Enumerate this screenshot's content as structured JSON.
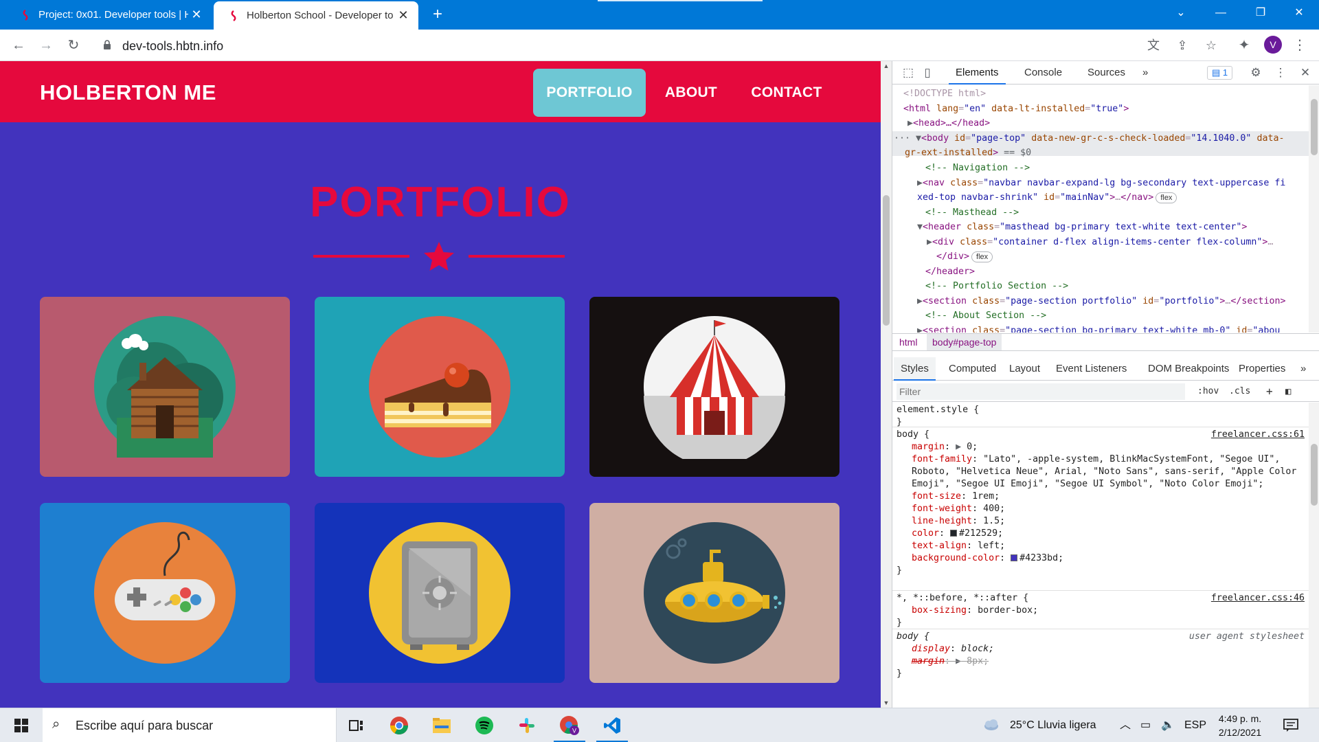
{
  "browser": {
    "tabs": [
      {
        "title": "Project: 0x01. Developer tools | H",
        "active": false
      },
      {
        "title": "Holberton School - Developer to",
        "active": true
      }
    ],
    "new_tab_icon": "plus-icon",
    "url": "dev-tools.hbtn.info",
    "profile_initial": "V"
  },
  "site": {
    "brand": "HOLBERTON ME",
    "nav": [
      {
        "label": "PORTFOLIO",
        "active": true
      },
      {
        "label": "ABOUT",
        "active": false
      },
      {
        "label": "CONTACT",
        "active": false
      }
    ],
    "section_title": "PORTFOLIO",
    "colors": {
      "primary": "#e5093d",
      "background": "#4233bd",
      "active_nav": "#6ec7d4"
    },
    "portfolio_items": [
      {
        "name": "cabin",
        "bg": "#b85a6e"
      },
      {
        "name": "cake",
        "bg": "#1fa3b6"
      },
      {
        "name": "circus",
        "bg": "#151010"
      },
      {
        "name": "game-controller",
        "bg": "#1e7fd0"
      },
      {
        "name": "safe",
        "bg": "#1433ba"
      },
      {
        "name": "submarine",
        "bg": "#cfaea3"
      }
    ]
  },
  "devtools": {
    "tabs": [
      "Elements",
      "Console",
      "Sources"
    ],
    "more_tabs": "»",
    "issues_count": "1",
    "dom": {
      "doctype": "<!DOCTYPE html>",
      "html_tag": "html",
      "html_attr": "lang",
      "html_val": "\"en\"",
      "html_attr2": "data-lt-installed",
      "html_val2": "\"true\"",
      "head": "<head>…</head>",
      "body_tag": "body",
      "body_attr": "id",
      "body_val": "\"page-top\"",
      "body_attr2": "data-new-gr-c-s-check-loaded",
      "body_val2": "\"14.1040.0\"",
      "body_attr3a": "data-",
      "body_attr3b": "gr-ext-installed",
      "body_eq": "== $0",
      "cmt_nav": "<!-- Navigation -->",
      "nav_class_a": "\"navbar navbar-expand-lg bg-secondary text-uppercase fi",
      "nav_class_b": "xed-top navbar-shrink\"",
      "nav_id": "\"mainNav\"",
      "cmt_masthead": "<!-- Masthead -->",
      "header_class": "\"masthead bg-primary text-white text-center\"",
      "div_class": "\"container d-flex align-items-center flex-column\"",
      "cmt_portfolio": "<!-- Portfolio Section -->",
      "section1_class": "\"page-section portfolio\"",
      "section1_id": "\"portfolio\"",
      "cmt_about": "<!-- About Section -->",
      "section2_class": "\"page-section bg-primary text-white mb-0\"",
      "section2_id": "\"abou",
      "flex_badge": "flex"
    },
    "breadcrumbs": [
      "html",
      "body#page-top"
    ],
    "subtabs": [
      "Styles",
      "Computed",
      "Layout",
      "Event Listeners",
      "DOM Breakpoints",
      "Properties"
    ],
    "filter_placeholder": "Filter",
    "hov_label": ":hov",
    "cls_label": ".cls",
    "styles": {
      "element_style": "element.style {",
      "close": "}",
      "body_selector": "body {",
      "body_source": "freelancer.css:61",
      "margin": "0;",
      "font_family": "\"Lato\", -apple-system, BlinkMacSystemFont, \"Segoe UI\", Roboto, \"Helvetica Neue\", Arial, \"Noto Sans\", sans-serif, \"Apple Color Emoji\", \"Segoe UI Emoji\", \"Segoe UI Symbol\", \"Noto Color Emoji\";",
      "font_size": "1rem;",
      "font_weight": "400;",
      "line_height": "1.5;",
      "color": "#212529;",
      "text_align": "left;",
      "background_color": "#4233bd;",
      "universal_selector": "*, *::before, *::after {",
      "universal_source": "freelancer.css:46",
      "box_sizing": "border-box;",
      "ua_selector": "body {",
      "ua_source": "user agent stylesheet",
      "display": "block;",
      "ua_margin": "8px;"
    }
  },
  "taskbar": {
    "search_placeholder": "Escribe aquí para buscar",
    "weather": "25°C  Lluvia ligera",
    "language": "ESP",
    "time": "4:49 p. m.",
    "date": "2/12/2021"
  }
}
